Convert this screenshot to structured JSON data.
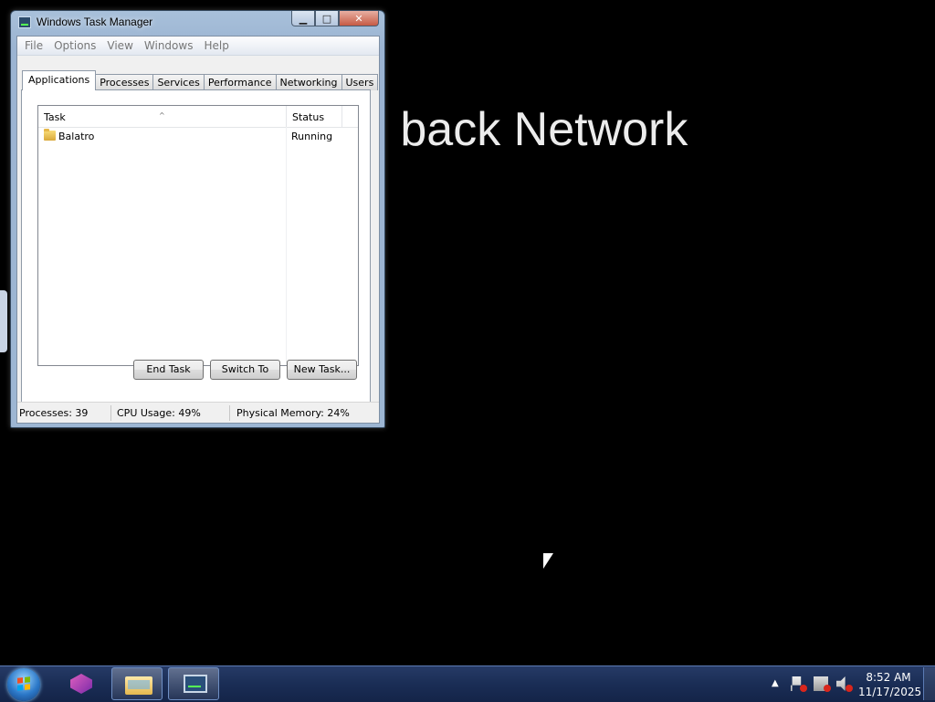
{
  "background": {
    "text": "e back Network"
  },
  "window": {
    "title": "Windows Task Manager",
    "caption_buttons": {
      "minimize": "▁",
      "maximize": "□",
      "close": "✕"
    },
    "menu": [
      "File",
      "Options",
      "View",
      "Windows",
      "Help"
    ],
    "tabs": [
      "Applications",
      "Processes",
      "Services",
      "Performance",
      "Networking",
      "Users"
    ],
    "active_tab": "Applications",
    "list": {
      "columns": {
        "task": "Task",
        "status": "Status"
      },
      "sort_indicator": "^",
      "rows": [
        {
          "task": "Balatro",
          "status": "Running",
          "icon": "folder-icon"
        }
      ]
    },
    "buttons": {
      "end_task": "End Task",
      "switch_to": "Switch To",
      "new_task": "New Task..."
    },
    "status_bar": {
      "processes": "Processes: 39",
      "cpu": "CPU Usage: 49%",
      "memory": "Physical Memory: 24%"
    }
  },
  "taskbar": {
    "items": [
      {
        "name": "balatro-app",
        "icon": "cube-icon"
      },
      {
        "name": "windows-explorer",
        "icon": "folder-icon"
      },
      {
        "name": "task-manager",
        "icon": "task-manager-icon",
        "active": true
      }
    ],
    "tray": {
      "show_hidden": "▲",
      "icons": [
        "action-center-flag-icon",
        "network-icon",
        "volume-muted-icon"
      ]
    },
    "clock": {
      "time": "8:52 AM",
      "date": "11/17/2025"
    }
  },
  "colors": {
    "desktop": "#000000",
    "taskbar": "#1a2d55",
    "window_frame": "#9db6d3",
    "tray_error_badge": "#d9261c"
  }
}
